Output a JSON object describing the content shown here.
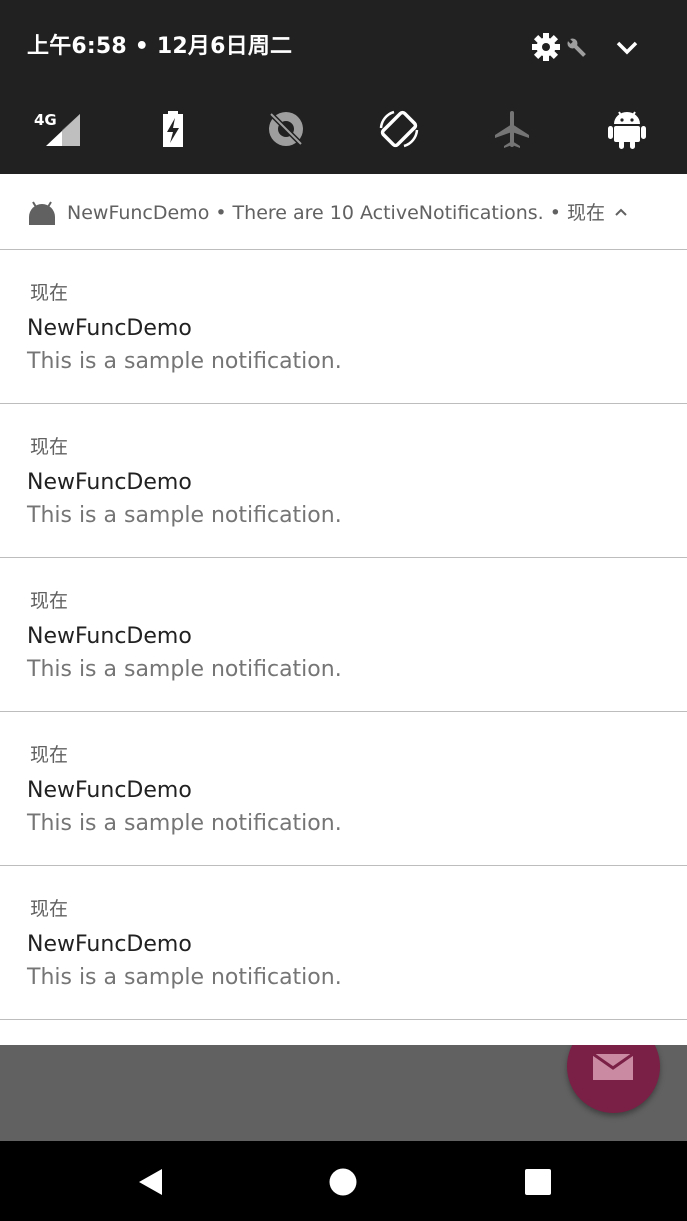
{
  "status": {
    "datetime": "上午6:58 • 12月6日周二",
    "network_label": "4G"
  },
  "quick_settings": {
    "tiles": [
      {
        "name": "cellular-signal-icon"
      },
      {
        "name": "battery-saver-icon"
      },
      {
        "name": "location-off-icon"
      },
      {
        "name": "auto-rotate-icon"
      },
      {
        "name": "airplane-mode-icon"
      },
      {
        "name": "android-icon"
      }
    ]
  },
  "group": {
    "app_name": "NewFuncDemo",
    "summary": "There are 10 ActiveNotifications.",
    "time": "现在",
    "separator": "•"
  },
  "notifications": [
    {
      "time": "现在",
      "title": "NewFuncDemo",
      "text": "This is a sample notification."
    },
    {
      "time": "现在",
      "title": "NewFuncDemo",
      "text": "This is a sample notification."
    },
    {
      "time": "现在",
      "title": "NewFuncDemo",
      "text": "This is a sample notification."
    },
    {
      "time": "现在",
      "title": "NewFuncDemo",
      "text": "This is a sample notification."
    },
    {
      "time": "现在",
      "title": "NewFuncDemo",
      "text": "This is a sample notification."
    }
  ],
  "colors": {
    "header_bg": "#212121",
    "fab": "#7a1f45",
    "navbar": "#000000"
  }
}
